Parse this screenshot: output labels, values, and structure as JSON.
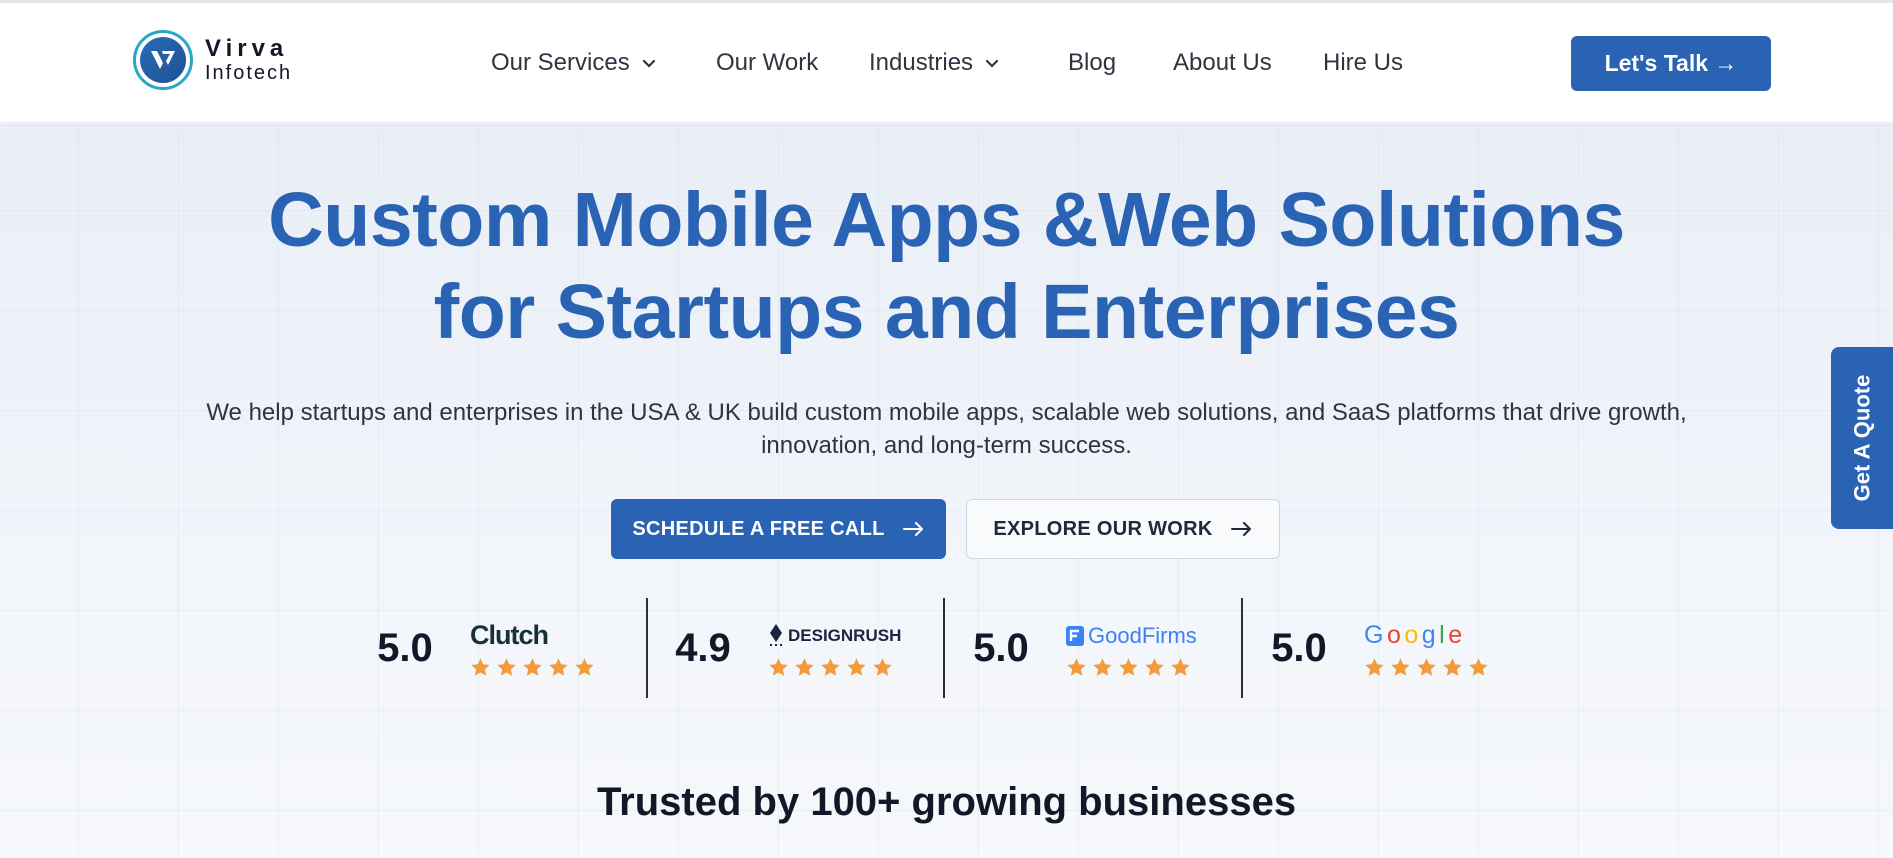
{
  "brand": {
    "logo_line1": "Virva",
    "logo_line2": "Infotech",
    "logo_icon": "virva-v-logo-icon",
    "primary_color": "#2a63b3",
    "accent_color": "#f39a3b"
  },
  "nav": {
    "items": [
      {
        "label": "Our Services",
        "has_dropdown": true
      },
      {
        "label": "Our Work",
        "has_dropdown": false
      },
      {
        "label": "Industries",
        "has_dropdown": true
      },
      {
        "label": "Blog",
        "has_dropdown": false
      },
      {
        "label": "About Us",
        "has_dropdown": false
      },
      {
        "label": "Hire Us",
        "has_dropdown": false
      }
    ],
    "cta_label": "Let's Talk →"
  },
  "hero": {
    "title_line1": "Custom Mobile Apps &Web Solutions",
    "title_line2": "for Startups and Enterprises",
    "subtitle_line1": "We help startups and enterprises in the USA & UK build custom mobile apps, scalable web solutions, and SaaS platforms that drive growth,",
    "subtitle_line2": "innovation, and long-term success.",
    "primary_button": "SCHEDULE A FREE CALL",
    "secondary_button": "EXPLORE OUR WORK"
  },
  "ratings": [
    {
      "score": "5.0",
      "platform": "Clutch",
      "stars": 5
    },
    {
      "score": "4.9",
      "platform": "DESIGNRUSH",
      "stars": 5
    },
    {
      "score": "5.0",
      "platform": "GoodFirms",
      "stars": 5
    },
    {
      "score": "5.0",
      "platform": "Google",
      "stars": 5
    }
  ],
  "trusted_heading": "Trusted by 100+ growing businesses",
  "side_tab": "Get A Quote"
}
